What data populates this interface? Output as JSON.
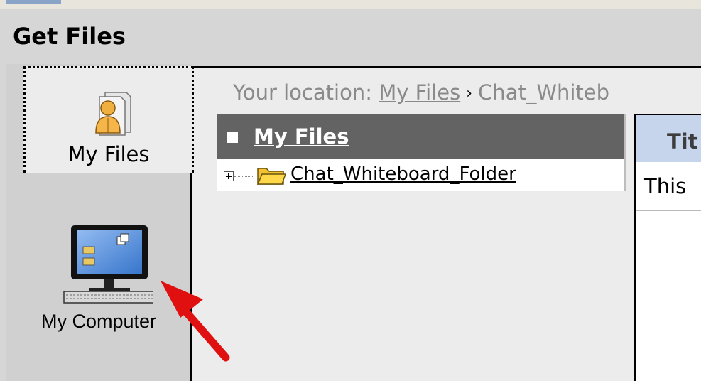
{
  "page": {
    "title": "Get Files"
  },
  "tabs": [
    {
      "label": "My Files",
      "icon": "user-files-icon",
      "selected": true
    },
    {
      "label": "My Computer",
      "icon": "computer-icon",
      "selected": false
    }
  ],
  "breadcrumb": {
    "prefix": "Your location:",
    "root_link": "My Files",
    "separator": "›",
    "current": "Chat_Whiteb"
  },
  "tree": {
    "root_label": "My Files",
    "items": [
      {
        "label": "Chat_Whiteboard_Folder",
        "icon": "folder-icon",
        "expand_icon": "plus-icon"
      }
    ]
  },
  "detail": {
    "column_header": "Tit",
    "first_row_text": "This"
  },
  "colors": {
    "tree_header_bg": "#636363",
    "column_header_bg": "#c6d4ec",
    "annotation_arrow": "#e01010"
  }
}
